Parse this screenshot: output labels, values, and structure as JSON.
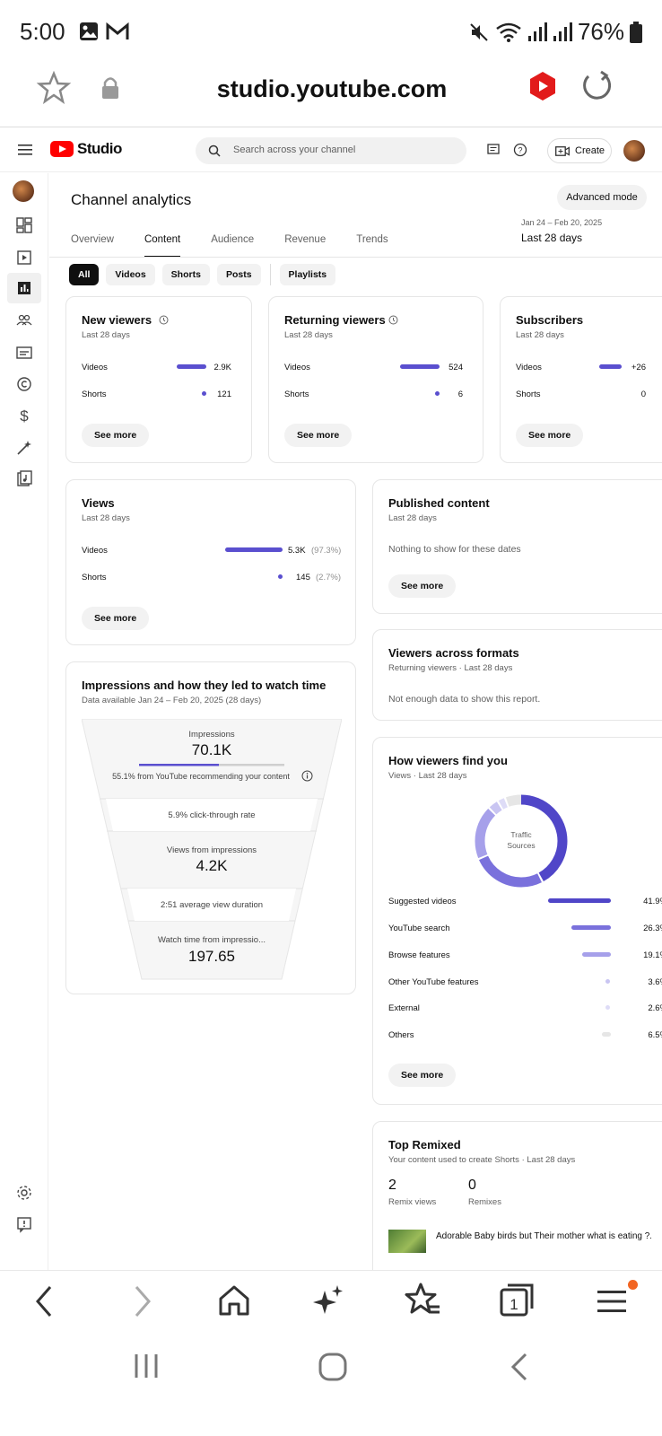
{
  "status": {
    "time": "5:00",
    "battery": "76%"
  },
  "browser": {
    "url": "studio.youtube.com"
  },
  "studio": {
    "brand": "Studio",
    "search_placeholder": "Search across your channel",
    "create_label": "Create"
  },
  "page": {
    "title": "Channel analytics",
    "advanced_mode": "Advanced mode",
    "tabs": [
      "Overview",
      "Content",
      "Audience",
      "Revenue",
      "Trends"
    ],
    "date_range": "Jan 24 – Feb 20, 2025",
    "date_period": "Last 28 days",
    "chips": [
      "All",
      "Videos",
      "Shorts",
      "Posts",
      "Playlists"
    ]
  },
  "cards": {
    "new_viewers": {
      "title": "New viewers",
      "subtitle": "Last 28 days",
      "rows": [
        {
          "label": "Videos",
          "value": "2.9K"
        },
        {
          "label": "Shorts",
          "value": "121"
        }
      ],
      "see_more": "See more"
    },
    "returning_viewers": {
      "title": "Returning viewers",
      "subtitle": "Last 28 days",
      "rows": [
        {
          "label": "Videos",
          "value": "524"
        },
        {
          "label": "Shorts",
          "value": "6"
        }
      ],
      "see_more": "See more"
    },
    "subscribers": {
      "title": "Subscribers",
      "subtitle": "Last 28 days",
      "rows": [
        {
          "label": "Videos",
          "value": "+26"
        },
        {
          "label": "Shorts",
          "value": "0"
        }
      ]
    },
    "views": {
      "title": "Views",
      "subtitle": "Last 28 days",
      "rows": [
        {
          "label": "Videos",
          "value": "5.3K",
          "pct": "(97.3%)"
        },
        {
          "label": "Shorts",
          "value": "145",
          "pct": "(2.7%)"
        }
      ],
      "see_more": "See more"
    },
    "published": {
      "title": "Published content",
      "subtitle": "Last 28 days",
      "empty": "Nothing to show for these dates",
      "see_more": "See more"
    },
    "formats": {
      "title": "Viewers across formats",
      "subtitle": "Returning viewers · Last 28 days",
      "empty": "Not enough data to show this report."
    },
    "impressions": {
      "title": "Impressions and how they led to watch time",
      "subtitle": "Data available Jan 24 – Feb 20, 2025 (28 days)",
      "impressions_label": "Impressions",
      "impressions_value": "70.1K",
      "recommend_note": "55.1% from YouTube recommending your content",
      "ctr": "5.9% click-through rate",
      "views_label": "Views from impressions",
      "views_value": "4.2K",
      "avg_duration": "2:51 average view duration",
      "watch_label": "Watch time from impressio...",
      "watch_value": "197.65"
    },
    "find_you": {
      "title": "How viewers find you",
      "subtitle": "Views · Last 28 days",
      "donut_label_1": "Traffic",
      "donut_label_2": "Sources",
      "sources": [
        {
          "label": "Suggested videos",
          "value": "41.9%"
        },
        {
          "label": "YouTube search",
          "value": "26.3%"
        },
        {
          "label": "Browse features",
          "value": "19.1%"
        },
        {
          "label": "Other YouTube features",
          "value": "3.6%"
        },
        {
          "label": "External",
          "value": "2.6%"
        },
        {
          "label": "Others",
          "value": "6.5%"
        }
      ],
      "see_more": "See more"
    },
    "remixed": {
      "title": "Top Remixed",
      "subtitle": "Your content used to create Shorts · Last 28 days",
      "remix_views": "2",
      "remix_views_label": "Remix views",
      "remixes": "0",
      "remixes_label": "Remixes",
      "video_title": "Adorable Baby birds but Their mother what is eating ?..."
    }
  },
  "colors": {
    "accent": "#5a4fcf",
    "brand_red": "#ff0000"
  }
}
